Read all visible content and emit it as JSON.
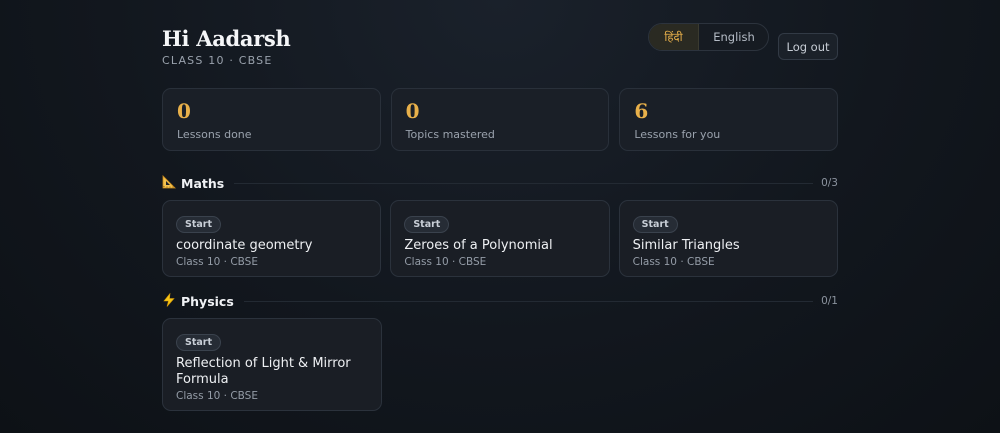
{
  "header": {
    "greeting": "Hi Aadarsh",
    "subline": "CLASS 10 · CBSE",
    "languages": [
      "हिंदी",
      "English"
    ],
    "active_language": "हिंदी",
    "logout_label": "Log out"
  },
  "stats": [
    {
      "value": "0",
      "label": "Lessons done"
    },
    {
      "value": "0",
      "label": "Topics mastered"
    },
    {
      "value": "6",
      "label": "Lessons for you"
    }
  ],
  "sections": [
    {
      "icon": "triangular-ruler-icon",
      "title": "Maths",
      "count": "0/3",
      "lessons": [
        {
          "badge": "Start",
          "title": "coordinate geometry",
          "meta": "Class 10 · CBSE"
        },
        {
          "badge": "Start",
          "title": "Zeroes of a Polynomial",
          "meta": "Class 10 · CBSE"
        },
        {
          "badge": "Start",
          "title": "Similar Triangles",
          "meta": "Class 10 · CBSE"
        }
      ]
    },
    {
      "icon": "lightning-icon",
      "title": "Physics",
      "count": "0/1",
      "lessons": [
        {
          "badge": "Start",
          "title": "Reflection of Light & Mirror Formula",
          "meta": "Class 10 · CBSE"
        }
      ]
    }
  ],
  "colors": {
    "accent": "#e8b04a",
    "background": "#12171e",
    "card": "#1a1e25"
  }
}
